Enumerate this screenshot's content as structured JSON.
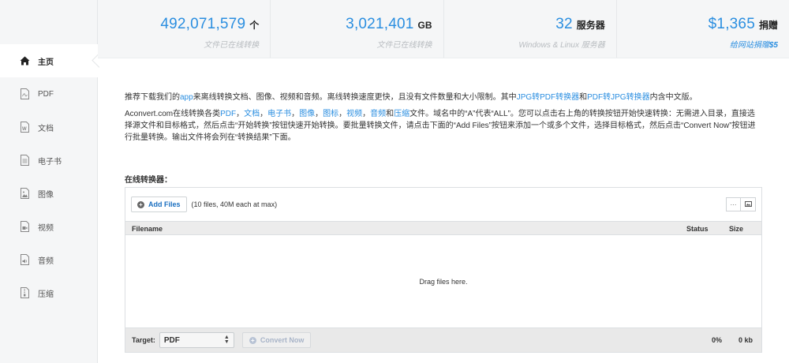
{
  "sidebar": {
    "items": [
      {
        "label": "主页",
        "icon": "home-icon",
        "active": true
      },
      {
        "label": "PDF",
        "icon": "pdf-file-icon",
        "active": false
      },
      {
        "label": "文档",
        "icon": "word-file-icon",
        "active": false
      },
      {
        "label": "电子书",
        "icon": "ebook-file-icon",
        "active": false
      },
      {
        "label": "图像",
        "icon": "image-file-icon",
        "active": false
      },
      {
        "label": "视频",
        "icon": "video-file-icon",
        "active": false
      },
      {
        "label": "音频",
        "icon": "audio-file-icon",
        "active": false
      },
      {
        "label": "压缩",
        "icon": "archive-file-icon",
        "active": false
      }
    ]
  },
  "stats": [
    {
      "number": "492,071,579",
      "unit": "个",
      "sub": "文件已在线转换"
    },
    {
      "number": "3,021,401",
      "unit": "GB",
      "sub": "文件已在线转换"
    },
    {
      "number": "32",
      "unit": "服务器",
      "sub": "Windows & Linux 服务器"
    },
    {
      "number": "$1,365",
      "unit": "捐赠",
      "sub_prefix": "给网站捐赠",
      "sub_highlight": "$5"
    }
  ],
  "intro": {
    "p1_a": "推荐下载我们的",
    "p1_app": "app",
    "p1_b": "来离线转换文档、图像、视频和音频。离线转换速度更快，且没有文件数量和大小限制。其中",
    "p1_link1": "JPG转PDF转换器",
    "p1_c": "和",
    "p1_link2": "PDF转JPG转换器",
    "p1_d": "内含中文版。",
    "p2_a": "Aconvert.com在线转换各类",
    "p2_pdf": "PDF",
    "p2_doc": "文档",
    "p2_ebook": "电子书",
    "p2_image": "图像",
    "p2_icon": "图标",
    "p2_video": "视频",
    "p2_audio": "音频",
    "p2_and": "和",
    "p2_archive": "压缩",
    "sep": "，",
    "p2_b": "文件。域名中的“A”代表“ALL”。您可以点击右上角的转换按钮开始快速转换：无需进入目录，直接选择源文件和目标格式，然后点击“开始转换”按钮快速开始转换。要批量转换文件，请点击下面的“Add Files”按钮来添加一个或多个文件，选择目标格式，然后点击“Convert Now”按钮进行批量转换。输出文件将会列在“转换结果”下面。"
  },
  "converter": {
    "title": "在线转换器：",
    "add_files": "Add Files",
    "limit": "(10 files, 40M each at max)",
    "view_list": "···",
    "view_thumb": "▪",
    "col_filename": "Filename",
    "col_status": "Status",
    "col_size": "Size",
    "drop_text": "Drag files here.",
    "target_label": "Target:",
    "target_value": "PDF",
    "convert_now": "Convert Now",
    "progress_pct": "0%",
    "total_size": "0 kb"
  },
  "colors": {
    "accent": "#2a8ee0",
    "sidebar_bg": "#f5f6f7"
  }
}
